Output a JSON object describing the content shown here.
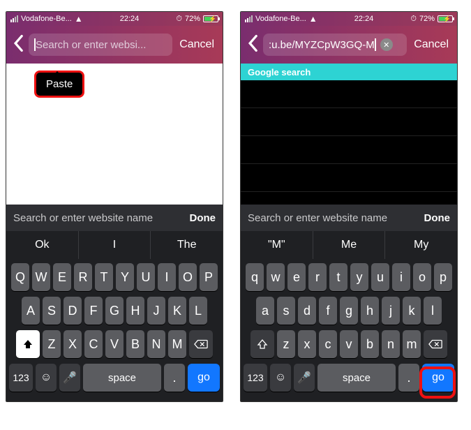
{
  "status": {
    "carrier": "Vodafone-Be...",
    "time": "22:24",
    "battery": "72%",
    "alarm_icon": "alarm-icon"
  },
  "left": {
    "search_placeholder": "Search or enter websi...",
    "cancel": "Cancel",
    "paste_menu": "Paste",
    "accessory_hint": "Search or enter website name",
    "accessory_done": "Done",
    "suggestions": [
      "Ok",
      "I",
      "The"
    ],
    "row1": [
      "Q",
      "W",
      "E",
      "R",
      "T",
      "Y",
      "U",
      "I",
      "O",
      "P"
    ],
    "row2": [
      "A",
      "S",
      "D",
      "F",
      "G",
      "H",
      "J",
      "K",
      "L"
    ],
    "row3": [
      "Z",
      "X",
      "C",
      "V",
      "B",
      "N",
      "M"
    ],
    "num_key": "123",
    "space_label": "space",
    "dot_label": ".",
    "go_label": "go"
  },
  "right": {
    "search_value": ":u.be/MYZCpW3GQ-M",
    "cancel": "Cancel",
    "suggest_banner": "Google search",
    "accessory_hint": "Search or enter website name",
    "accessory_done": "Done",
    "suggestions": [
      "\"M\"",
      "Me",
      "My"
    ],
    "row1": [
      "q",
      "w",
      "e",
      "r",
      "t",
      "y",
      "u",
      "i",
      "o",
      "p"
    ],
    "row2": [
      "a",
      "s",
      "d",
      "f",
      "g",
      "h",
      "j",
      "k",
      "l"
    ],
    "row3": [
      "z",
      "x",
      "c",
      "v",
      "b",
      "n",
      "m"
    ],
    "num_key": "123",
    "space_label": "space",
    "dot_label": ".",
    "go_label": "go"
  }
}
